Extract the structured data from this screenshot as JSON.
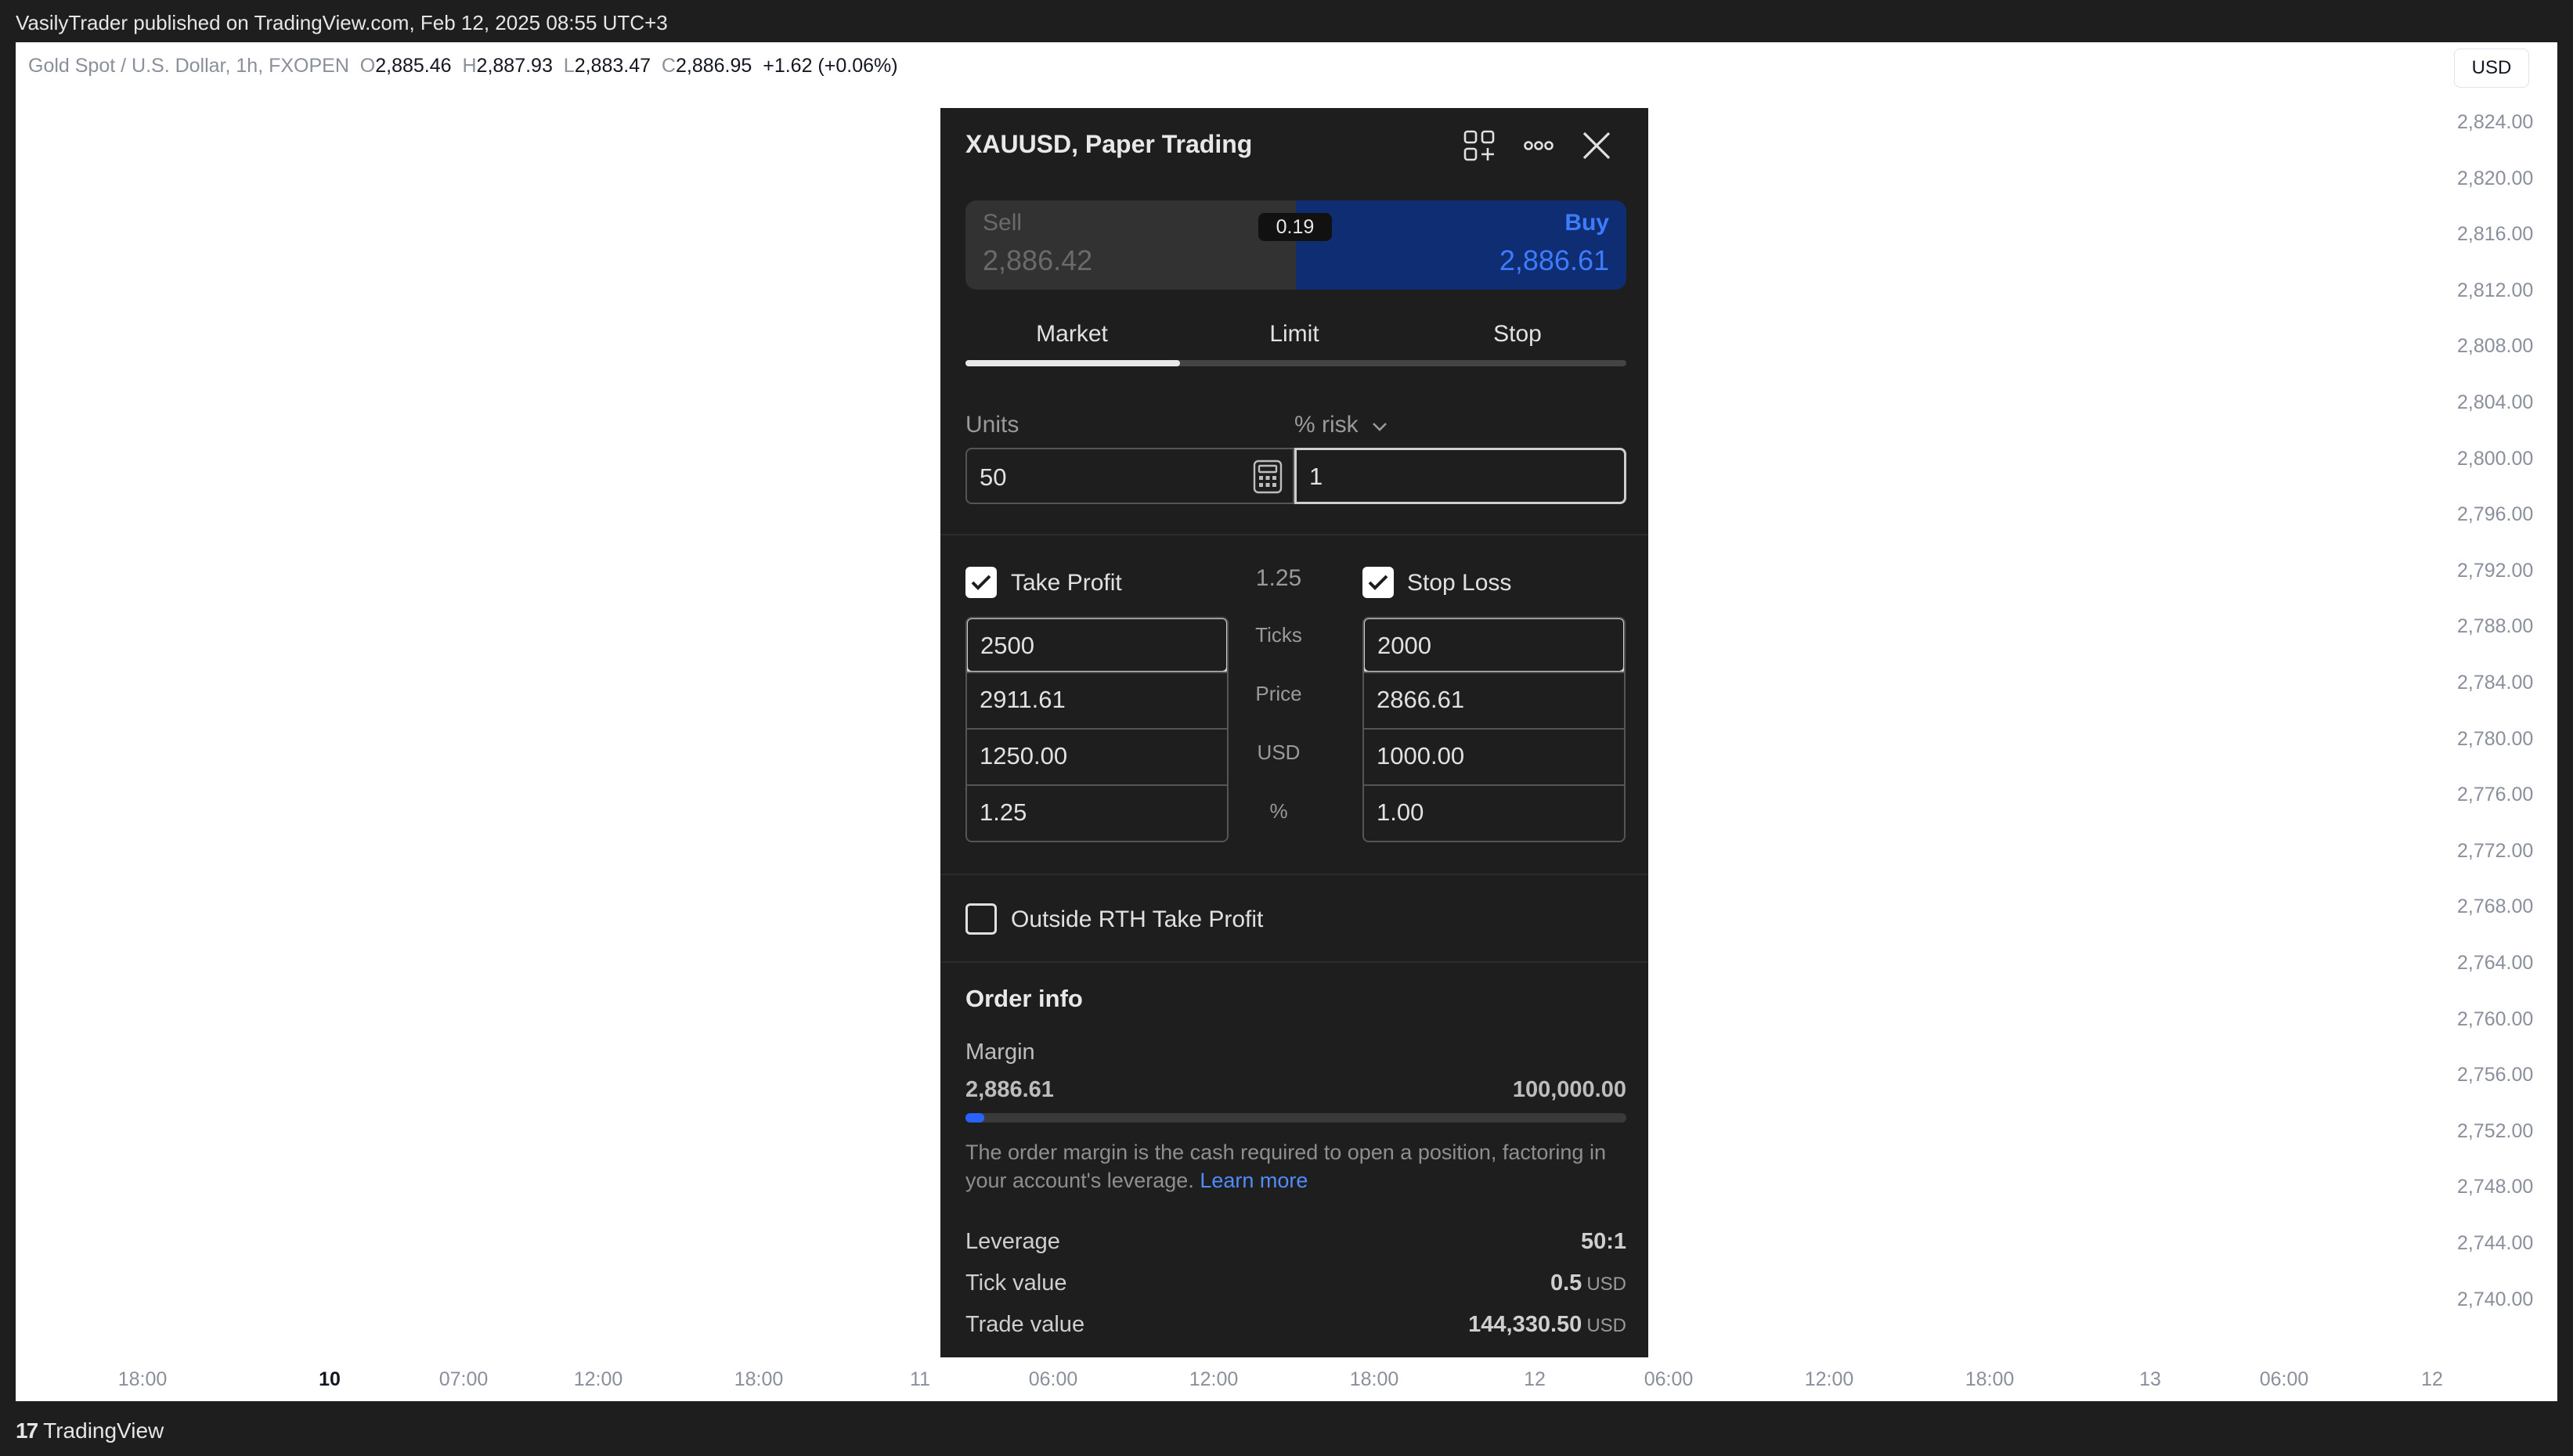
{
  "header": {
    "published_text": "VasilyTrader published on TradingView.com, Feb 12, 2025 08:55 UTC+3"
  },
  "legend": {
    "symbol": "Gold Spot / U.S. Dollar, 1h, FXOPEN",
    "o_label": "O",
    "o_value": "2,885.46",
    "h_label": "H",
    "h_value": "2,887.93",
    "l_label": "L",
    "l_value": "2,883.47",
    "c_label": "C",
    "c_value": "2,886.95",
    "change": "+1.62 (+0.06%)"
  },
  "currency_button": "USD",
  "y_axis": [
    "2,824.00",
    "2,820.00",
    "2,816.00",
    "2,812.00",
    "2,808.00",
    "2,804.00",
    "2,800.00",
    "2,796.00",
    "2,792.00",
    "2,788.00",
    "2,784.00",
    "2,780.00",
    "2,776.00",
    "2,772.00",
    "2,768.00",
    "2,764.00",
    "2,760.00",
    "2,756.00",
    "2,752.00",
    "2,748.00",
    "2,744.00",
    "2,740.00"
  ],
  "x_axis": [
    "18:00",
    "10",
    "07:00",
    "12:00",
    "18:00",
    "11",
    "06:00",
    "12:00",
    "18:00",
    "12",
    "06:00",
    "12:00",
    "18:00",
    "13",
    "06:00",
    "12"
  ],
  "footer": {
    "brand": "TradingView",
    "logo_mark": "17"
  },
  "panel": {
    "title": "XAUUSD, Paper Trading",
    "sell": {
      "label": "Sell",
      "price": "2,886.42"
    },
    "buy": {
      "label": "Buy",
      "price": "2,886.61"
    },
    "spread": "0.19",
    "tabs": [
      "Market",
      "Limit",
      "Stop"
    ],
    "active_tab": "Market",
    "units_label": "Units",
    "risk_label": "% risk",
    "units_value": "50",
    "risk_value": "1",
    "take_profit": {
      "label": "Take Profit",
      "checked": true,
      "ticks": "2500",
      "price": "2911.61",
      "usd": "1250.00",
      "percent": "1.25"
    },
    "stop_loss": {
      "label": "Stop Loss",
      "checked": true,
      "ticks": "2000",
      "price": "2866.61",
      "usd": "1000.00",
      "percent": "1.00"
    },
    "ratio": "1.25",
    "row_labels": {
      "ticks": "Ticks",
      "price": "Price",
      "usd": "USD",
      "percent": "%"
    },
    "outside_rth": {
      "label": "Outside RTH Take Profit",
      "checked": false
    },
    "order_info": {
      "title": "Order info",
      "margin_label": "Margin",
      "margin_value": "2,886.61",
      "margin_total": "100,000.00",
      "margin_fraction": 0.0289,
      "note": "The order margin is the cash required to open a position, factoring in your account's leverage.",
      "learn_more": "Learn more",
      "leverage_label": "Leverage",
      "leverage_value": "50:1",
      "tick_value_label": "Tick value",
      "tick_value": "0.5",
      "tick_value_unit": "USD",
      "trade_value_label": "Trade value",
      "trade_value": "144,330.50",
      "trade_value_unit": "USD"
    }
  }
}
